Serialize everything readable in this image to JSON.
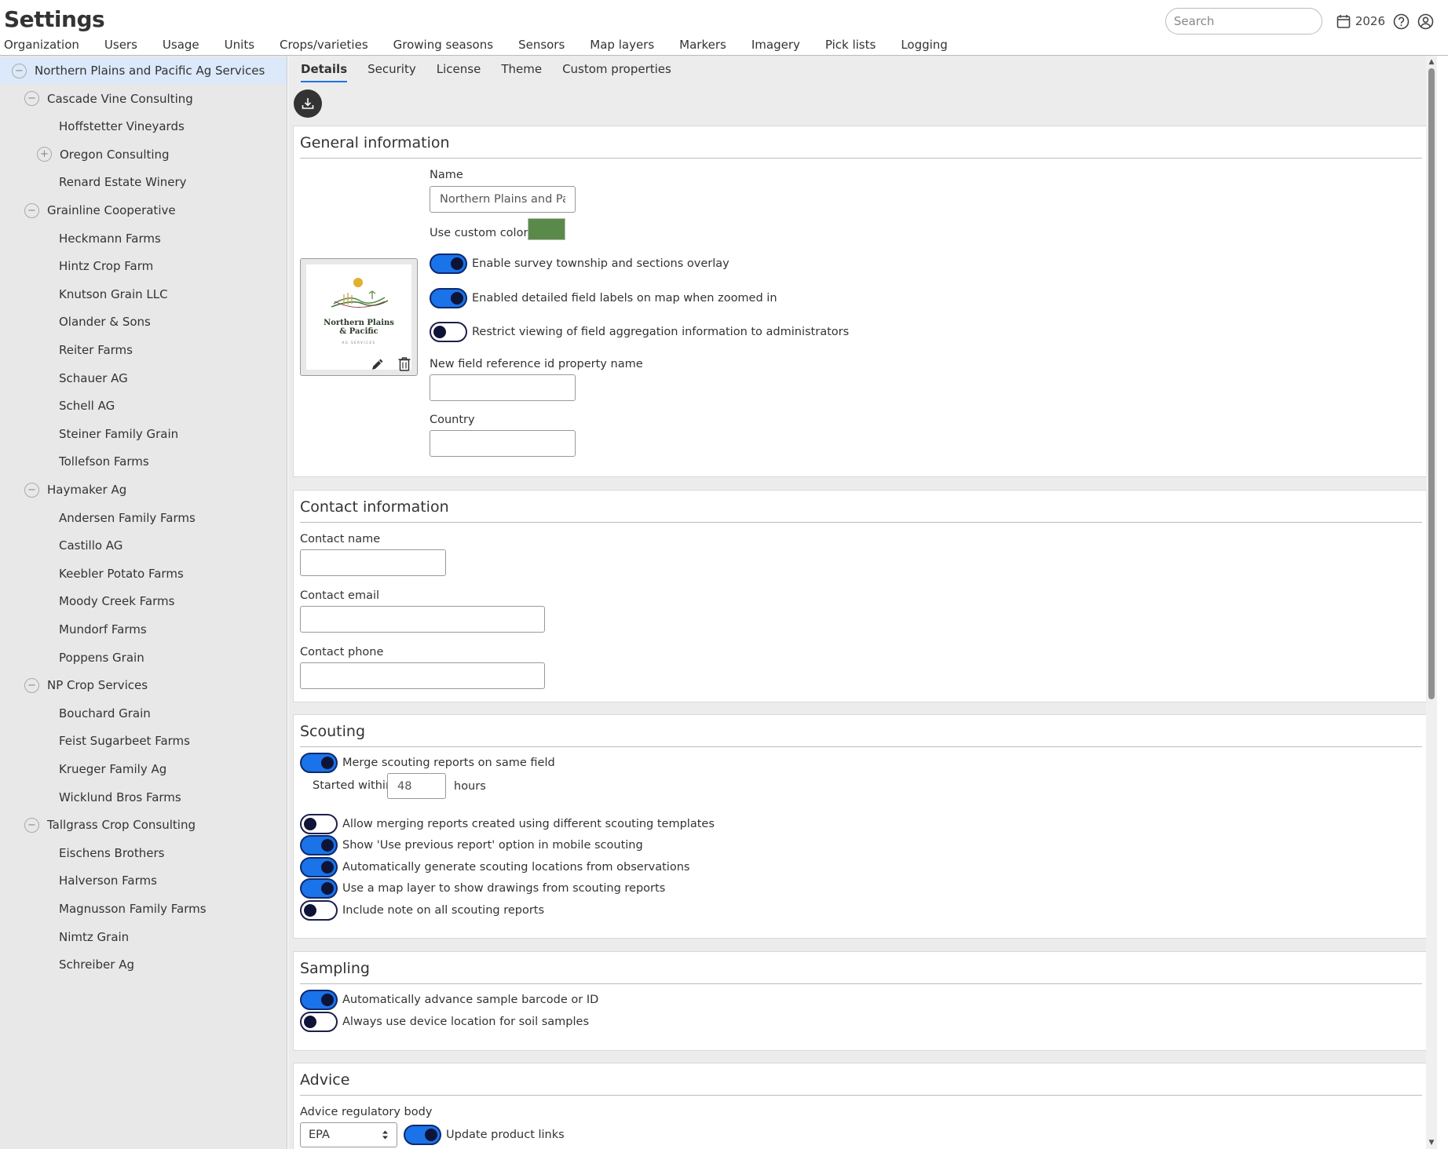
{
  "header": {
    "title": "Settings",
    "search_placeholder": "Search",
    "year": "2026"
  },
  "main_tabs": [
    "Organization",
    "Users",
    "Usage",
    "Units",
    "Crops/varieties",
    "Growing seasons",
    "Sensors",
    "Map layers",
    "Markers",
    "Imagery",
    "Pick lists",
    "Logging"
  ],
  "sidebar": {
    "items": [
      {
        "label": "Northern Plains and Pacific Ag Services",
        "level": 0,
        "toggle": "collapse",
        "selected": true
      },
      {
        "label": "Cascade Vine Consulting",
        "level": 1,
        "toggle": "collapse"
      },
      {
        "label": "Hoffstetter Vineyards",
        "level": 2,
        "toggle": "none"
      },
      {
        "label": "Oregon Consulting",
        "level": 2,
        "toggle": "expand"
      },
      {
        "label": "Renard Estate Winery",
        "level": 2,
        "toggle": "none"
      },
      {
        "label": "Grainline Cooperative",
        "level": 1,
        "toggle": "collapse"
      },
      {
        "label": "Heckmann Farms",
        "level": 2,
        "toggle": "none"
      },
      {
        "label": "Hintz Crop Farm",
        "level": 2,
        "toggle": "none"
      },
      {
        "label": "Knutson Grain LLC",
        "level": 2,
        "toggle": "none"
      },
      {
        "label": "Olander & Sons",
        "level": 2,
        "toggle": "none"
      },
      {
        "label": "Reiter Farms",
        "level": 2,
        "toggle": "none"
      },
      {
        "label": "Schauer AG",
        "level": 2,
        "toggle": "none"
      },
      {
        "label": "Schell AG",
        "level": 2,
        "toggle": "none"
      },
      {
        "label": "Steiner Family Grain",
        "level": 2,
        "toggle": "none"
      },
      {
        "label": "Tollefson Farms",
        "level": 2,
        "toggle": "none"
      },
      {
        "label": "Haymaker Ag",
        "level": 1,
        "toggle": "collapse"
      },
      {
        "label": "Andersen Family Farms",
        "level": 2,
        "toggle": "none"
      },
      {
        "label": "Castillo AG",
        "level": 2,
        "toggle": "none"
      },
      {
        "label": "Keebler Potato Farms",
        "level": 2,
        "toggle": "none"
      },
      {
        "label": "Moody Creek Farms",
        "level": 2,
        "toggle": "none"
      },
      {
        "label": "Mundorf Farms",
        "level": 2,
        "toggle": "none"
      },
      {
        "label": "Poppens Grain",
        "level": 2,
        "toggle": "none"
      },
      {
        "label": "NP Crop Services",
        "level": 1,
        "toggle": "collapse"
      },
      {
        "label": "Bouchard Grain",
        "level": 2,
        "toggle": "none"
      },
      {
        "label": "Feist Sugarbeet Farms",
        "level": 2,
        "toggle": "none"
      },
      {
        "label": "Krueger Family Ag",
        "level": 2,
        "toggle": "none"
      },
      {
        "label": "Wicklund Bros Farms",
        "level": 2,
        "toggle": "none"
      },
      {
        "label": "Tallgrass Crop Consulting",
        "level": 1,
        "toggle": "collapse"
      },
      {
        "label": "Eischens Brothers",
        "level": 2,
        "toggle": "none"
      },
      {
        "label": "Halverson Farms",
        "level": 2,
        "toggle": "none"
      },
      {
        "label": "Magnusson Family Farms",
        "level": 2,
        "toggle": "none"
      },
      {
        "label": "Nimtz Grain",
        "level": 2,
        "toggle": "none"
      },
      {
        "label": "Schreiber Ag",
        "level": 2,
        "toggle": "none"
      }
    ]
  },
  "sub_tabs": [
    "Details",
    "Security",
    "License",
    "Theme",
    "Custom properties"
  ],
  "general": {
    "title": "General information",
    "name_label": "Name",
    "name_value": "Northern Plains and Pacific Ag Services",
    "custom_color_label": "Use custom color",
    "custom_color": "#5a8a4a",
    "toggle_survey": {
      "label": "Enable survey township and sections overlay",
      "on": true
    },
    "toggle_labels": {
      "label": "Enabled detailed field labels on map when zoomed in",
      "on": true
    },
    "toggle_restrict": {
      "label": "Restrict viewing of field aggregation information to administrators",
      "on": false
    },
    "ref_id_label": "New field reference id property name",
    "ref_id_value": "",
    "country_label": "Country",
    "country_value": "",
    "logo": {
      "line1": "Northern Plains",
      "line2": "& Pacific",
      "line3": "AG SERVICES"
    }
  },
  "contact": {
    "title": "Contact information",
    "name_label": "Contact name",
    "email_label": "Contact email",
    "phone_label": "Contact phone"
  },
  "scouting": {
    "title": "Scouting",
    "merge": {
      "label": "Merge scouting reports on same field",
      "on": true
    },
    "started_within_label": "Started within",
    "started_within_value": "48",
    "hours_label": "hours",
    "allow_merge": {
      "label": "Allow merging reports created using different scouting templates",
      "on": false
    },
    "show_previous": {
      "label": "Show 'Use previous report' option in mobile scouting",
      "on": true
    },
    "auto_locations": {
      "label": "Automatically generate scouting locations from observations",
      "on": true
    },
    "map_layer": {
      "label": "Use a map layer to show drawings from scouting reports",
      "on": true
    },
    "include_note": {
      "label": "Include note on all scouting reports",
      "on": false
    }
  },
  "sampling": {
    "title": "Sampling",
    "auto_advance": {
      "label": "Automatically advance sample barcode or ID",
      "on": true
    },
    "device_location": {
      "label": "Always use device location for soil samples",
      "on": false
    }
  },
  "advice": {
    "title": "Advice",
    "regulatory_label": "Advice regulatory body",
    "regulatory_value": "EPA",
    "update_links": {
      "label": "Update product links",
      "on": true
    }
  },
  "colors": {
    "accent": "#1a73e8",
    "toggle_knob": "#0e1438",
    "sidebar_bg": "#e8e8e8",
    "selected_bg": "#dbe9fa"
  }
}
